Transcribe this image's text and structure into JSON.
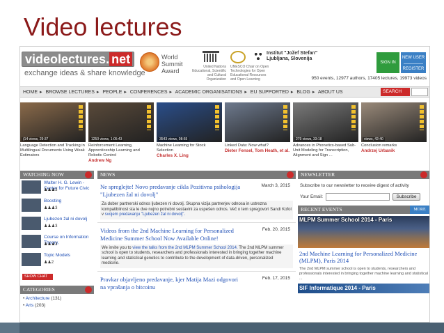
{
  "slide": {
    "title": "Video lectures"
  },
  "header": {
    "logo_main": "videolectures",
    "logo_net": "net",
    "tagline": "exchange ideas & share knowledge",
    "wsa_text": "World Summit Award",
    "unesco_text": "United Nations Educational, Scientific and Cultural Organization",
    "unitwin_label": "uni twin",
    "unitwin_text": "UNESCO Chair on Open Technologies for Open Educational Resources and Open Learning",
    "ijs_text": "Institut \"Jožef Stefan\" Ljubljana, Slovenija",
    "signin_label": "SIGN IN",
    "newuser_label": "NEW USER",
    "register_label": "REGISTER",
    "stats": "950 events, 12977 authors, 17405 lectures, 19973 videos"
  },
  "nav": {
    "items": [
      "HOME",
      "BROWSE LECTURES",
      "PEOPLE",
      "CONFERENCES",
      "ACADEMIC ORGANISATIONS",
      "EU SUPPORTED",
      "BLOG",
      "ABOUT US"
    ],
    "search_label": "SEARCH"
  },
  "thumbnails": [
    {
      "views": "(14 views, 29:37",
      "title": "Language Detection and Tracking in Multilingual Documents Using Weak Estimators",
      "author": "",
      "bg": "#8a6a4a"
    },
    {
      "views": "1250 views, 1:05:43",
      "title": "Reinforcement Learning, Apprenticeship Learning and Robotic Control",
      "author": "Andrew Ng",
      "bg": "#5a4a3a"
    },
    {
      "views": "3543 views, 08:55",
      "title": "Machine Learning for Stock Selection",
      "author": "Charles X. Ling",
      "bg": "#2a4e8a"
    },
    {
      "views": "",
      "title": "Linked Data: Now what?",
      "author": "Dieter Fensel, Tom Heath, et al.",
      "bg": "#6e7a8e"
    },
    {
      "views": "279 views, 33:18",
      "title": "Advances in Phonetics-based Sub-Unit Modeling for Transcription, Alignment and Sign ...",
      "author": "",
      "bg": "#7a7a7a"
    },
    {
      "views": "views, 42:40",
      "title": "Conclusion remarks",
      "author": "Andrzej Urbanik",
      "bg": "#9a8a7a"
    }
  ],
  "watching_now": {
    "heading": "WATCHING NOW",
    "items": [
      {
        "label": "Walter H. G. Lewin - Center for Future Civic",
        "rating": "3"
      },
      {
        "label": "Boosting",
        "rating": "3"
      },
      {
        "label": "Ljubezen žal ni dovolj",
        "rating": "3"
      },
      {
        "label": "Course on Information Theory,",
        "rating": "3"
      },
      {
        "label": "Topic Models",
        "rating": "2"
      }
    ],
    "showchat_label": "SHOW CHAT"
  },
  "categories": {
    "heading": "CATEGORIES",
    "items": [
      {
        "name": "Architecture",
        "count": "(131)"
      },
      {
        "name": "Arts",
        "count": "(203)"
      }
    ]
  },
  "news": {
    "heading": "NEWS",
    "items": [
      {
        "title": "Ne spreglejte! Novo predavanje cikla Pozitivna psihologija \"Ljubezen žal ni dovolj\"",
        "date": "March 3, 2015",
        "body_pre": "Za dober partnerski odnos ljubezen ni dovolj. Skupna vizija partnerjev odnosa in ustrezna kompatibilnost sta le dve nujno potrebni sestavini za uspešen odnos. Več o tem spregovori Sandi Kofol v ",
        "body_link": "svojem predavanju \"Ljubezen žal ni dovolj\".",
        "body_post": ""
      },
      {
        "title": "Videos from the 2nd Machine Learning for Personalized Medicine Summer School Now Available Online!",
        "date": "Feb. 20, 2015",
        "body_pre": "We invite you to ",
        "body_link": "view the talks from the 2nd MLPM Summer School 2014.",
        "body_post": " The 2nd MLPM summer school is open to students, researchers and professionals interested in bringing together machine learning and statistical genetics to contribute to the development of data-driven, personalized medicine."
      },
      {
        "title": "Pravkar objavljeno predavanje, kjer Matija Mazi odgovori na vprašanja o bitcoinu",
        "date": "Feb. 17, 2015",
        "body_pre": "",
        "body_link": "",
        "body_post": ""
      }
    ]
  },
  "newsletter": {
    "heading": "NEWSLETTER",
    "text": "Subscribe to our newsletter to receive digest of activity",
    "email_label": "Your Email:",
    "subscribe_label": "Subscribe"
  },
  "recent_events": {
    "heading": "RECENT EVENTS",
    "more_label": "MORE",
    "banner_label": "MLPM Summer School 2014 - Paris",
    "event_title": "2nd Machine Learning for Personalized Medicine (MLPM), Paris 2014",
    "event_text": "The 2nd MLPM summer school is open to students, researchers and professionals interested in bringing together machine learning and statistical ...",
    "banner2_label": "SIF Informatique 2014 - Paris"
  }
}
